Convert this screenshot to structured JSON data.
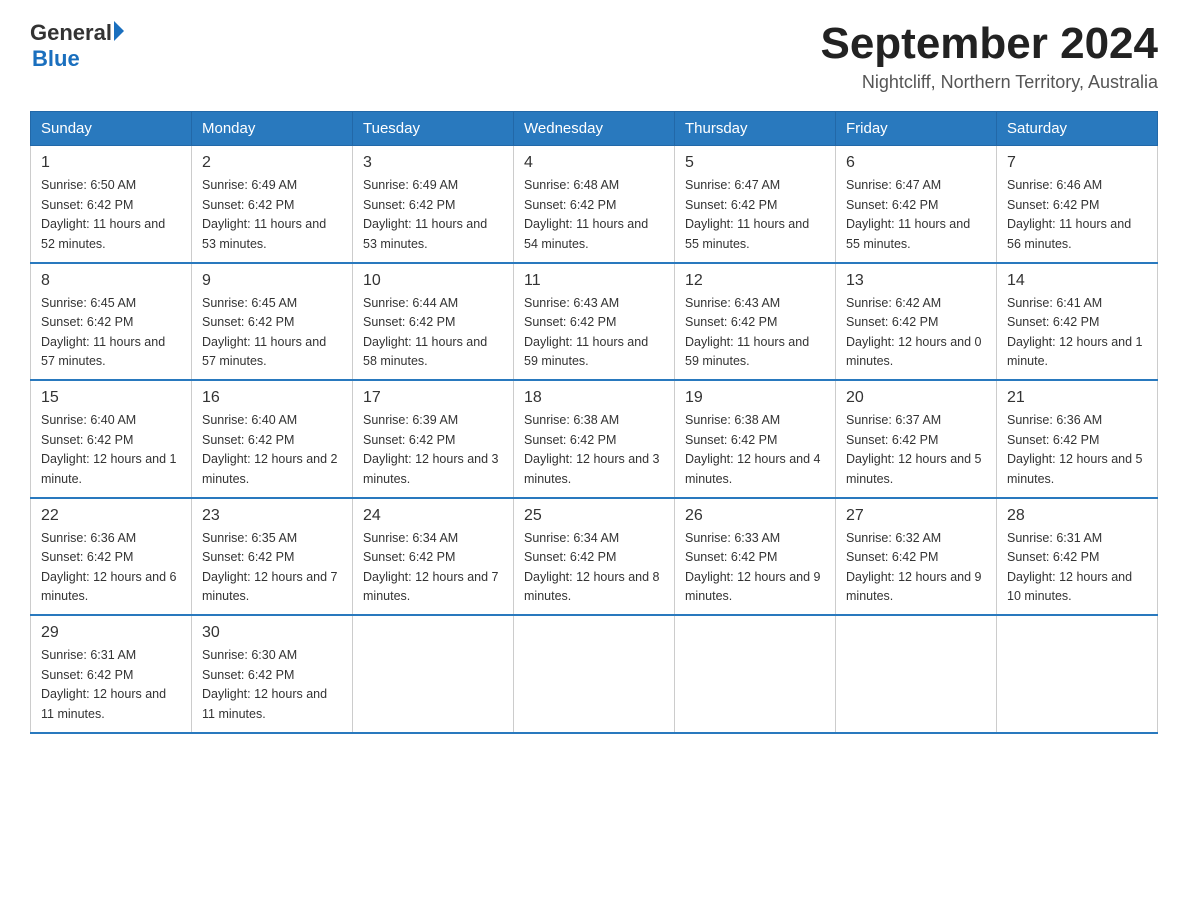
{
  "header": {
    "logo_general": "General",
    "logo_blue": "Blue",
    "month_year": "September 2024",
    "location": "Nightcliff, Northern Territory, Australia"
  },
  "weekdays": [
    "Sunday",
    "Monday",
    "Tuesday",
    "Wednesday",
    "Thursday",
    "Friday",
    "Saturday"
  ],
  "weeks": [
    [
      {
        "day": "1",
        "sunrise": "6:50 AM",
        "sunset": "6:42 PM",
        "daylight": "11 hours and 52 minutes."
      },
      {
        "day": "2",
        "sunrise": "6:49 AM",
        "sunset": "6:42 PM",
        "daylight": "11 hours and 53 minutes."
      },
      {
        "day": "3",
        "sunrise": "6:49 AM",
        "sunset": "6:42 PM",
        "daylight": "11 hours and 53 minutes."
      },
      {
        "day": "4",
        "sunrise": "6:48 AM",
        "sunset": "6:42 PM",
        "daylight": "11 hours and 54 minutes."
      },
      {
        "day": "5",
        "sunrise": "6:47 AM",
        "sunset": "6:42 PM",
        "daylight": "11 hours and 55 minutes."
      },
      {
        "day": "6",
        "sunrise": "6:47 AM",
        "sunset": "6:42 PM",
        "daylight": "11 hours and 55 minutes."
      },
      {
        "day": "7",
        "sunrise": "6:46 AM",
        "sunset": "6:42 PM",
        "daylight": "11 hours and 56 minutes."
      }
    ],
    [
      {
        "day": "8",
        "sunrise": "6:45 AM",
        "sunset": "6:42 PM",
        "daylight": "11 hours and 57 minutes."
      },
      {
        "day": "9",
        "sunrise": "6:45 AM",
        "sunset": "6:42 PM",
        "daylight": "11 hours and 57 minutes."
      },
      {
        "day": "10",
        "sunrise": "6:44 AM",
        "sunset": "6:42 PM",
        "daylight": "11 hours and 58 minutes."
      },
      {
        "day": "11",
        "sunrise": "6:43 AM",
        "sunset": "6:42 PM",
        "daylight": "11 hours and 59 minutes."
      },
      {
        "day": "12",
        "sunrise": "6:43 AM",
        "sunset": "6:42 PM",
        "daylight": "11 hours and 59 minutes."
      },
      {
        "day": "13",
        "sunrise": "6:42 AM",
        "sunset": "6:42 PM",
        "daylight": "12 hours and 0 minutes."
      },
      {
        "day": "14",
        "sunrise": "6:41 AM",
        "sunset": "6:42 PM",
        "daylight": "12 hours and 1 minute."
      }
    ],
    [
      {
        "day": "15",
        "sunrise": "6:40 AM",
        "sunset": "6:42 PM",
        "daylight": "12 hours and 1 minute."
      },
      {
        "day": "16",
        "sunrise": "6:40 AM",
        "sunset": "6:42 PM",
        "daylight": "12 hours and 2 minutes."
      },
      {
        "day": "17",
        "sunrise": "6:39 AM",
        "sunset": "6:42 PM",
        "daylight": "12 hours and 3 minutes."
      },
      {
        "day": "18",
        "sunrise": "6:38 AM",
        "sunset": "6:42 PM",
        "daylight": "12 hours and 3 minutes."
      },
      {
        "day": "19",
        "sunrise": "6:38 AM",
        "sunset": "6:42 PM",
        "daylight": "12 hours and 4 minutes."
      },
      {
        "day": "20",
        "sunrise": "6:37 AM",
        "sunset": "6:42 PM",
        "daylight": "12 hours and 5 minutes."
      },
      {
        "day": "21",
        "sunrise": "6:36 AM",
        "sunset": "6:42 PM",
        "daylight": "12 hours and 5 minutes."
      }
    ],
    [
      {
        "day": "22",
        "sunrise": "6:36 AM",
        "sunset": "6:42 PM",
        "daylight": "12 hours and 6 minutes."
      },
      {
        "day": "23",
        "sunrise": "6:35 AM",
        "sunset": "6:42 PM",
        "daylight": "12 hours and 7 minutes."
      },
      {
        "day": "24",
        "sunrise": "6:34 AM",
        "sunset": "6:42 PM",
        "daylight": "12 hours and 7 minutes."
      },
      {
        "day": "25",
        "sunrise": "6:34 AM",
        "sunset": "6:42 PM",
        "daylight": "12 hours and 8 minutes."
      },
      {
        "day": "26",
        "sunrise": "6:33 AM",
        "sunset": "6:42 PM",
        "daylight": "12 hours and 9 minutes."
      },
      {
        "day": "27",
        "sunrise": "6:32 AM",
        "sunset": "6:42 PM",
        "daylight": "12 hours and 9 minutes."
      },
      {
        "day": "28",
        "sunrise": "6:31 AM",
        "sunset": "6:42 PM",
        "daylight": "12 hours and 10 minutes."
      }
    ],
    [
      {
        "day": "29",
        "sunrise": "6:31 AM",
        "sunset": "6:42 PM",
        "daylight": "12 hours and 11 minutes."
      },
      {
        "day": "30",
        "sunrise": "6:30 AM",
        "sunset": "6:42 PM",
        "daylight": "12 hours and 11 minutes."
      },
      null,
      null,
      null,
      null,
      null
    ]
  ],
  "labels": {
    "sunrise": "Sunrise:",
    "sunset": "Sunset:",
    "daylight": "Daylight:"
  }
}
